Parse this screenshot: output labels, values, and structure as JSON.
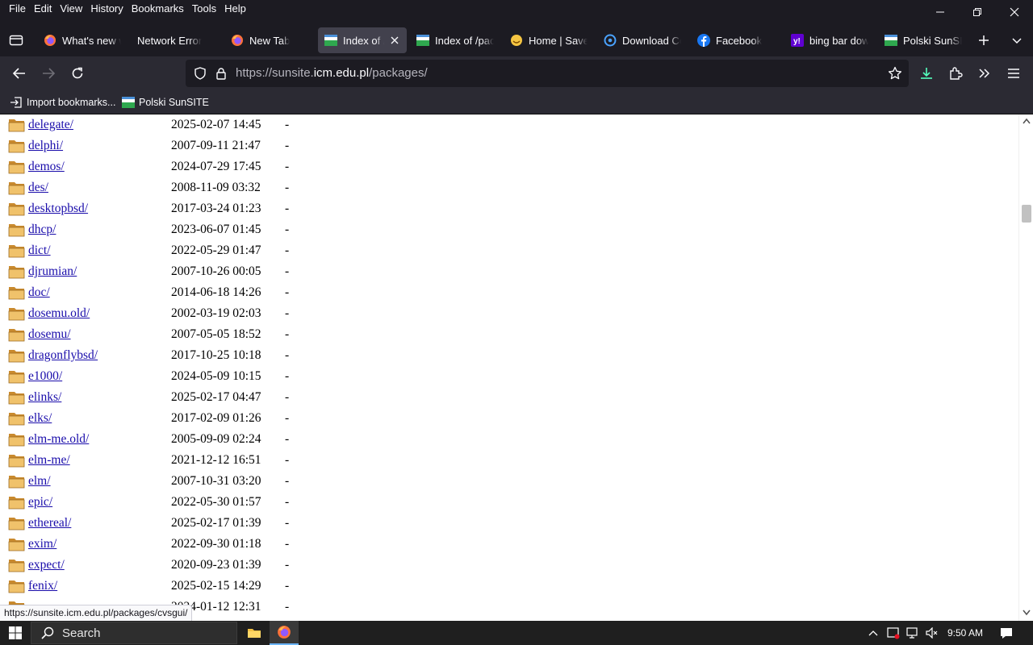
{
  "menubar": {
    "items": [
      "File",
      "Edit",
      "View",
      "History",
      "Bookmarks",
      "Tools",
      "Help"
    ]
  },
  "tabs": [
    {
      "title": "What's new w",
      "icon": "firefox-icon"
    },
    {
      "title": "Network Error",
      "icon": "none"
    },
    {
      "title": "New Tab",
      "icon": "firefox-icon"
    },
    {
      "title": "Index of /p",
      "icon": "sunsite-icon",
      "active": true
    },
    {
      "title": "Index of /pack",
      "icon": "sunsite-icon"
    },
    {
      "title": "Home | Save.c",
      "icon": "smiley-icon"
    },
    {
      "title": "Download Co",
      "icon": "download-site-icon"
    },
    {
      "title": "Facebook",
      "icon": "facebook-icon"
    },
    {
      "title": "bing bar dow",
      "icon": "yahoo-icon"
    },
    {
      "title": "Polski SunSITE",
      "icon": "sunsite-icon"
    }
  ],
  "urlbar": {
    "url_prefix": "https://sunsite.",
    "url_domain": "icm.edu.pl",
    "url_path": "/packages/"
  },
  "bookmarks": {
    "import_label": "Import bookmarks...",
    "sunsite_label": "Polski SunSITE"
  },
  "listing": [
    {
      "name": "delegate/",
      "date": "2025-02-07 14:45",
      "size": "-"
    },
    {
      "name": "delphi/",
      "date": "2007-09-11 21:47",
      "size": "-"
    },
    {
      "name": "demos/",
      "date": "2024-07-29 17:45",
      "size": "-"
    },
    {
      "name": "des/",
      "date": "2008-11-09 03:32",
      "size": "-"
    },
    {
      "name": "desktopbsd/",
      "date": "2017-03-24 01:23",
      "size": "-"
    },
    {
      "name": "dhcp/",
      "date": "2023-06-07 01:45",
      "size": "-"
    },
    {
      "name": "dict/",
      "date": "2022-05-29 01:47",
      "size": "-"
    },
    {
      "name": "djrumian/",
      "date": "2007-10-26 00:05",
      "size": "-"
    },
    {
      "name": "doc/",
      "date": "2014-06-18 14:26",
      "size": "-"
    },
    {
      "name": "dosemu.old/",
      "date": "2002-03-19 02:03",
      "size": "-"
    },
    {
      "name": "dosemu/",
      "date": "2007-05-05 18:52",
      "size": "-"
    },
    {
      "name": "dragonflybsd/",
      "date": "2017-10-25 10:18",
      "size": "-"
    },
    {
      "name": "e1000/",
      "date": "2024-05-09 10:15",
      "size": "-"
    },
    {
      "name": "elinks/",
      "date": "2025-02-17 04:47",
      "size": "-"
    },
    {
      "name": "elks/",
      "date": "2017-02-09 01:26",
      "size": "-"
    },
    {
      "name": "elm-me.old/",
      "date": "2005-09-09 02:24",
      "size": "-"
    },
    {
      "name": "elm-me/",
      "date": "2021-12-12 16:51",
      "size": "-"
    },
    {
      "name": "elm/",
      "date": "2007-10-31 03:20",
      "size": "-"
    },
    {
      "name": "epic/",
      "date": "2022-05-30 01:57",
      "size": "-"
    },
    {
      "name": "ethereal/",
      "date": "2025-02-17 01:39",
      "size": "-"
    },
    {
      "name": "exim/",
      "date": "2022-09-30 01:18",
      "size": "-"
    },
    {
      "name": "expect/",
      "date": "2020-09-23 01:39",
      "size": "-"
    },
    {
      "name": "fenix/",
      "date": "2025-02-15 14:29",
      "size": "-"
    },
    {
      "name": "",
      "date": "2024-01-12 12:31",
      "size": "-"
    }
  ],
  "status_link": "https://sunsite.icm.edu.pl/packages/cvsgui/",
  "taskbar": {
    "search_label": "Search",
    "time": "9:50 AM"
  },
  "colors": {
    "chrome_dark": "#1c1b22",
    "toolbar": "#2b2a33",
    "link": "#1a0dab",
    "folder": "#e8b15a",
    "download_accent": "#54ffbd"
  }
}
